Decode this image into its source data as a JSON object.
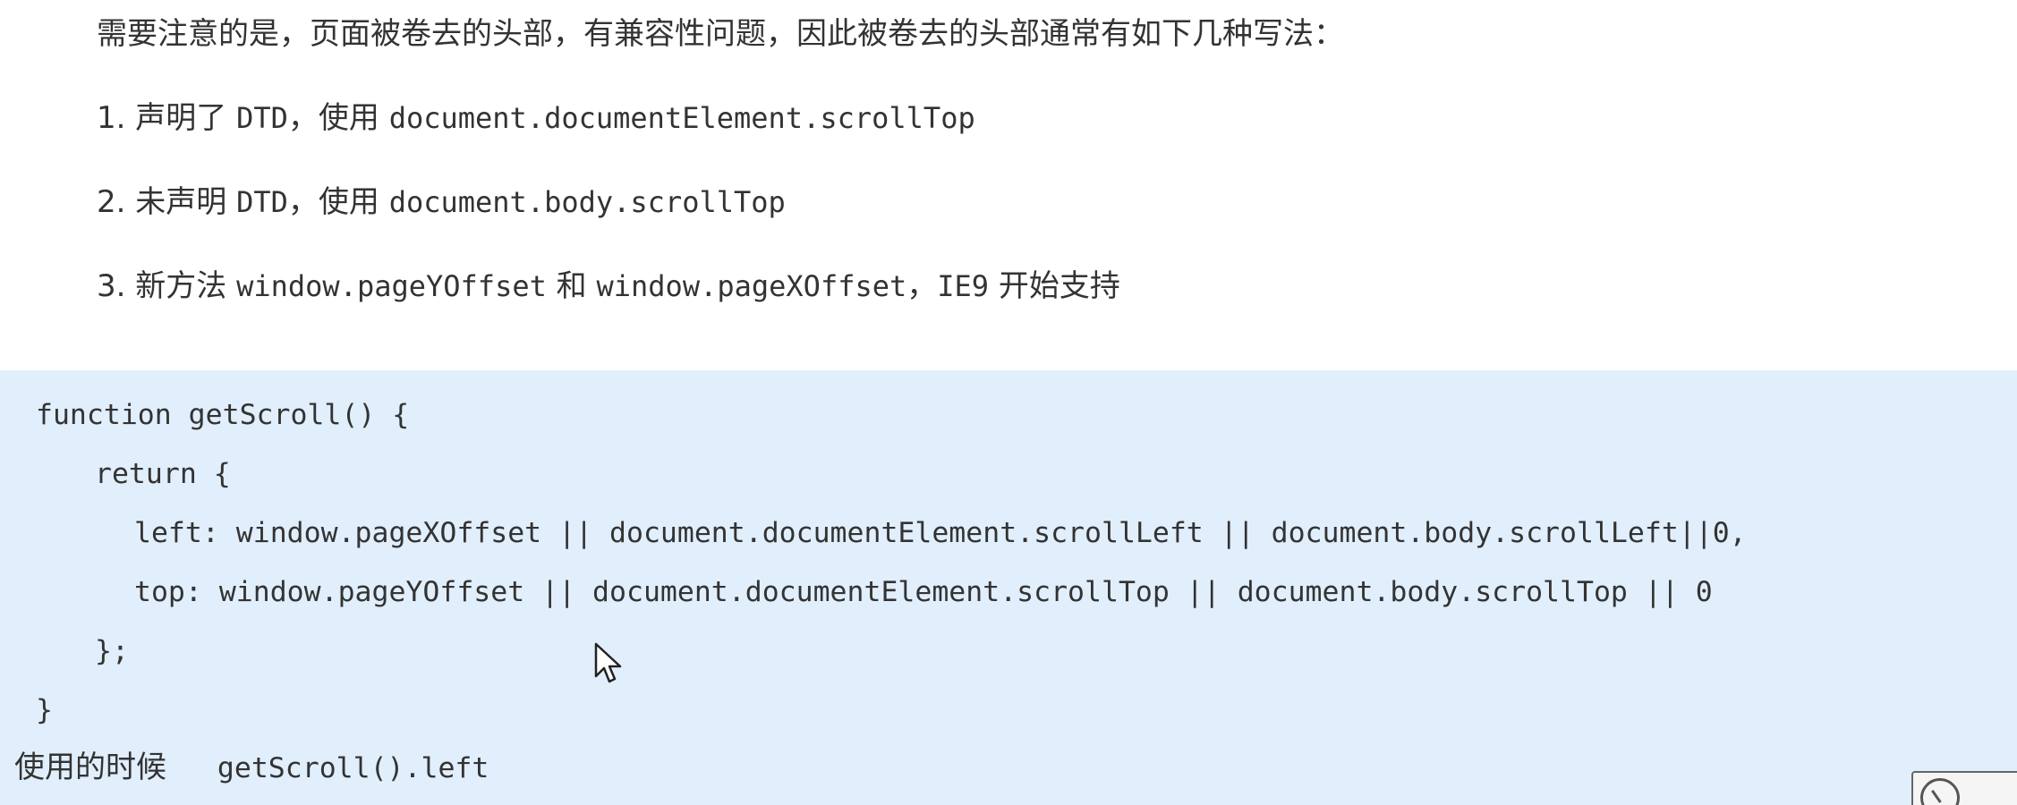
{
  "intro": {
    "text": "需要注意的是，页面被卷去的头部，有兼容性问题，因此被卷去的头部通常有如下几种写法："
  },
  "list": [
    {
      "number": "1.",
      "text_a": " 声明了 ",
      "code_a": "DTD",
      "text_b": "，使用 ",
      "code_b": "document.documentElement.scrollTop",
      "text_c": "",
      "code_c": "",
      "text_d": ""
    },
    {
      "number": "2.",
      "text_a": " 未声明 ",
      "code_a": "DTD",
      "text_b": "，使用 ",
      "code_b": "document.body.scrollTop",
      "text_c": "",
      "code_c": "",
      "text_d": ""
    },
    {
      "number": "3.",
      "text_a": " 新方法 ",
      "code_a": "window.pageYOffset",
      "text_b": " 和 ",
      "code_b": "window.pageXOffset",
      "text_c": "，",
      "code_c": "IE9",
      "text_d": " 开始支持"
    }
  ],
  "code": {
    "lines": [
      "function getScroll() {",
      "return {",
      "left: window.pageXOffset || document.documentElement.scrollLeft || document.body.scrollLeft||0,",
      "top: window.pageYOffset || document.documentElement.scrollTop || document.body.scrollTop || 0",
      "};",
      "}"
    ],
    "usage_label": "使用的时候",
    "usage_code": "getScroll().left"
  },
  "colors": {
    "code_background": "#e1eefc",
    "text": "#333333"
  },
  "icons": {
    "cursor": "mouse-pointer-icon",
    "corner": "clock-icon"
  }
}
